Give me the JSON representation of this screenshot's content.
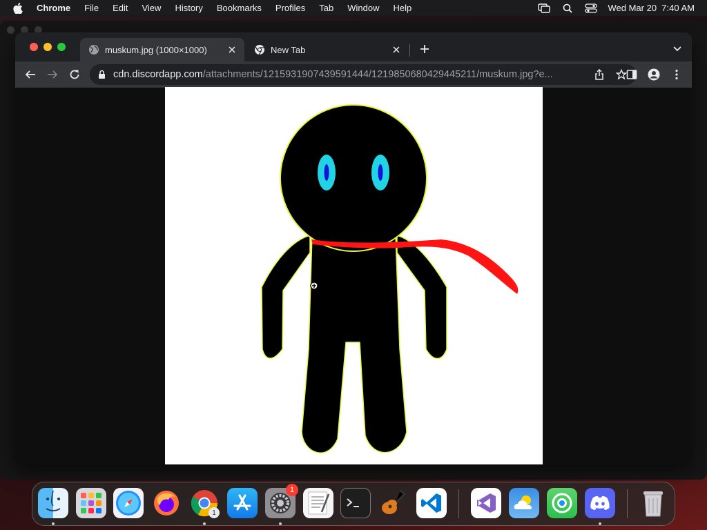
{
  "menubar": {
    "app": "Chrome",
    "items": [
      "File",
      "Edit",
      "View",
      "History",
      "Bookmarks",
      "Profiles",
      "Tab",
      "Window",
      "Help"
    ],
    "datetime": "Wed Mar 20  7:40 AM"
  },
  "tabs": [
    {
      "title": "muskum.jpg (1000×1000)",
      "active": true,
      "favicon": "globe-icon"
    },
    {
      "title": "New Tab",
      "active": false,
      "favicon": "chrome-icon"
    }
  ],
  "address": {
    "host": "cdn.discordapp.com",
    "path": "/attachments/1215931907439591444/1219850680429445211/muskum.jpg?e..."
  },
  "image": {
    "name": "muskum.jpg",
    "colors": {
      "figure": "#000000",
      "outline": "#e6f53a",
      "eye": "#22d3e6",
      "pupil": "#1414d6",
      "scarf": "#ff1414"
    }
  },
  "dock": {
    "apps": [
      "Finder",
      "Launchpad",
      "Safari",
      "Firefox",
      "Chrome",
      "App Store",
      "System Settings",
      "TextEdit",
      "Terminal",
      "GarageBand",
      "VS Code",
      "Visual Studio",
      "Weather",
      "Find My",
      "Discord",
      "Trash"
    ],
    "settings_badge": "1",
    "chrome_windows": "1"
  }
}
